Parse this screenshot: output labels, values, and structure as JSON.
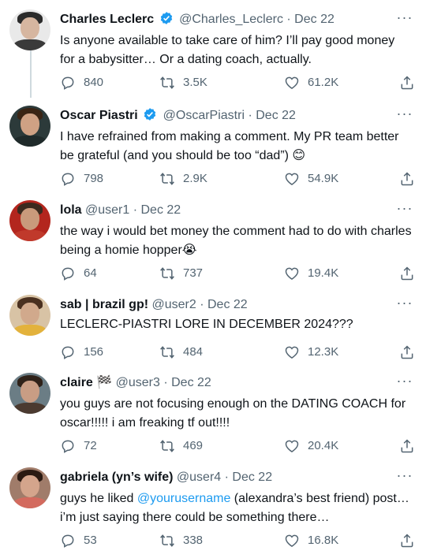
{
  "tweets": [
    {
      "name": "Charles Leclerc",
      "verified": true,
      "handle": "@Charles_Leclerc",
      "date": "Dec 22",
      "text": "Is anyone available to take care of him? I’ll pay good money for a babysitter… Or a dating coach, actually.",
      "replies": "840",
      "retweets": "3.5K",
      "likes": "61.2K",
      "avatar": {
        "bg": "#e9e9e9",
        "hair": "#2b2b2b",
        "skin": "#d6b6a0",
        "shirt": "#3a3a3a"
      }
    },
    {
      "name": "Oscar Piastri",
      "verified": true,
      "handle": "@OscarPiastri",
      "date": "Dec 22",
      "text": "I have refrained from making a comment. My PR team better be grateful (and you should be too “dad”) 😊",
      "replies": "798",
      "retweets": "2.9K",
      "likes": "54.9K",
      "avatar": {
        "bg": "#2c3a3a",
        "hair": "#3a2414",
        "skin": "#cfa184",
        "shirt": "#1f2a2a"
      }
    },
    {
      "name": "lola",
      "verified": false,
      "handle": "@user1",
      "date": "Dec 22",
      "text": "the way i would bet money the comment had to do with charles being a homie hopper😭",
      "replies": "64",
      "retweets": "737",
      "likes": "19.4K",
      "avatar": {
        "bg": "#b3261e",
        "hair": "#3b2a1f",
        "skin": "#c99a7c",
        "shirt": "#c0392b"
      }
    },
    {
      "name": "sab | brazil gp!",
      "verified": false,
      "handle": "@user2",
      "date": "Dec 22",
      "text": "LECLERC-PIASTRI LORE IN DECEMBER 2024???",
      "replies": "156",
      "retweets": "484",
      "likes": "12.3K",
      "avatar": {
        "bg": "#d8c3a5",
        "hair": "#4a3020",
        "skin": "#d1a98c",
        "shirt": "#e3b23c"
      }
    },
    {
      "name": "claire 🏁",
      "verified": false,
      "handle": "@user3",
      "date": "Dec 22",
      "text": "you guys are not focusing enough on the DATING COACH for oscar!!!!! i am freaking tf out!!!!",
      "replies": "72",
      "retweets": "469",
      "likes": "20.4K",
      "avatar": {
        "bg": "#6b7d85",
        "hair": "#2f2219",
        "skin": "#c89d84",
        "shirt": "#4b3a30"
      }
    },
    {
      "name": "gabriela (yn’s wife)",
      "verified": false,
      "handle": "@user4",
      "date": "Dec 22",
      "text_before": "guys he liked ",
      "mention": "@yourusername",
      "text_after": " (alexandra’s best friend) post… i’m just saying there could be something there…",
      "replies": "53",
      "retweets": "338",
      "likes": "16.8K",
      "avatar": {
        "bg": "#a07c6a",
        "hair": "#2a1a12",
        "skin": "#d4a58c",
        "shirt": "#d36a5e"
      }
    }
  ],
  "colors": {
    "verified": "#1d9bf0",
    "secondary": "#536471",
    "line": "#cfd9de"
  }
}
